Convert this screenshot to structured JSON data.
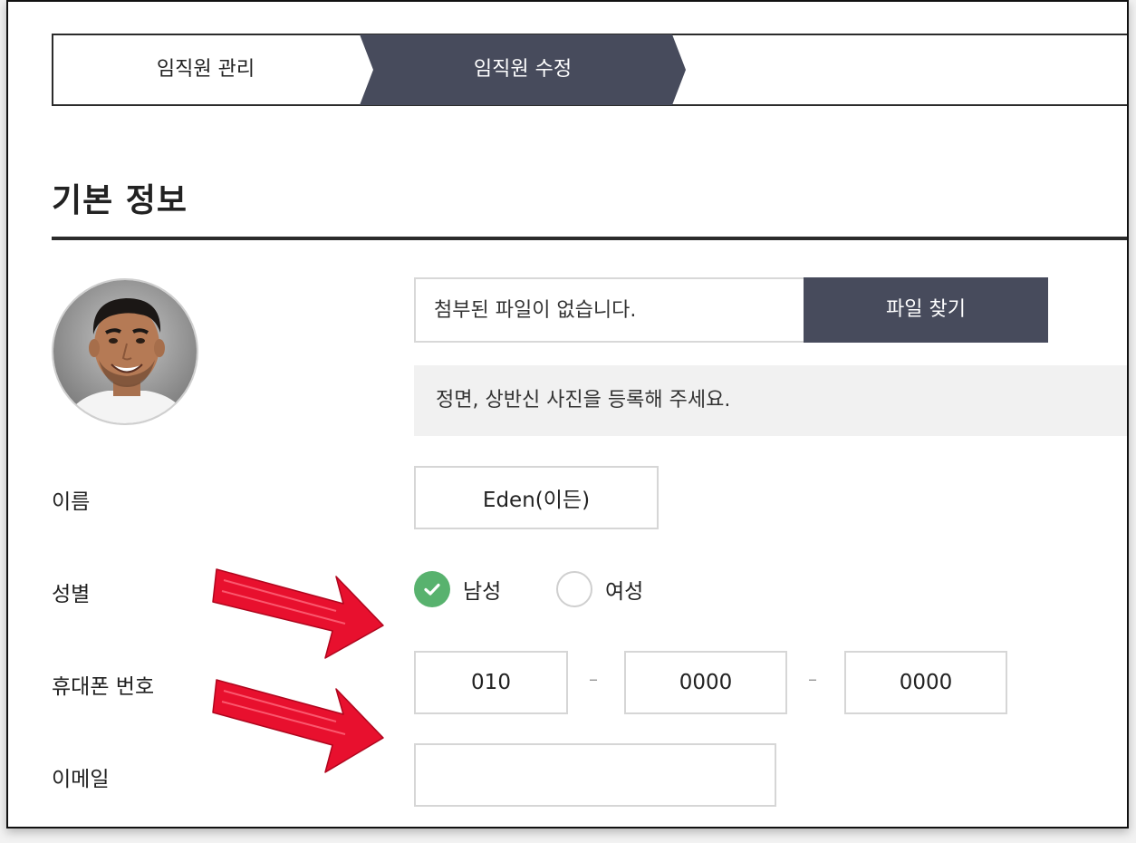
{
  "breadcrumb": {
    "steps": [
      {
        "label": "임직원 관리",
        "active": false
      },
      {
        "label": "임직원 수정",
        "active": true
      }
    ]
  },
  "section": {
    "title": "기본 정보"
  },
  "photo": {
    "file_status": "첨부된 파일이 없습니다.",
    "find_button": "파일 찾기",
    "hint": "정면, 상반신 사진을 등록해 주세요."
  },
  "form": {
    "name": {
      "label": "이름",
      "value": "Eden(이든)"
    },
    "gender": {
      "label": "성별",
      "options": [
        {
          "label": "남성",
          "selected": true
        },
        {
          "label": "여성",
          "selected": false
        }
      ]
    },
    "phone": {
      "label": "휴대폰 번호",
      "parts": [
        "010",
        "0000",
        "0000"
      ],
      "separator": "–"
    },
    "email": {
      "label": "이메일",
      "value": ""
    }
  },
  "colors": {
    "accent_dark": "#474b5c",
    "radio_selected": "#58b26e",
    "annotation_arrow": "#e8102e"
  },
  "icons": {
    "check": "check-icon",
    "annotation": "red-arrow-icon"
  }
}
